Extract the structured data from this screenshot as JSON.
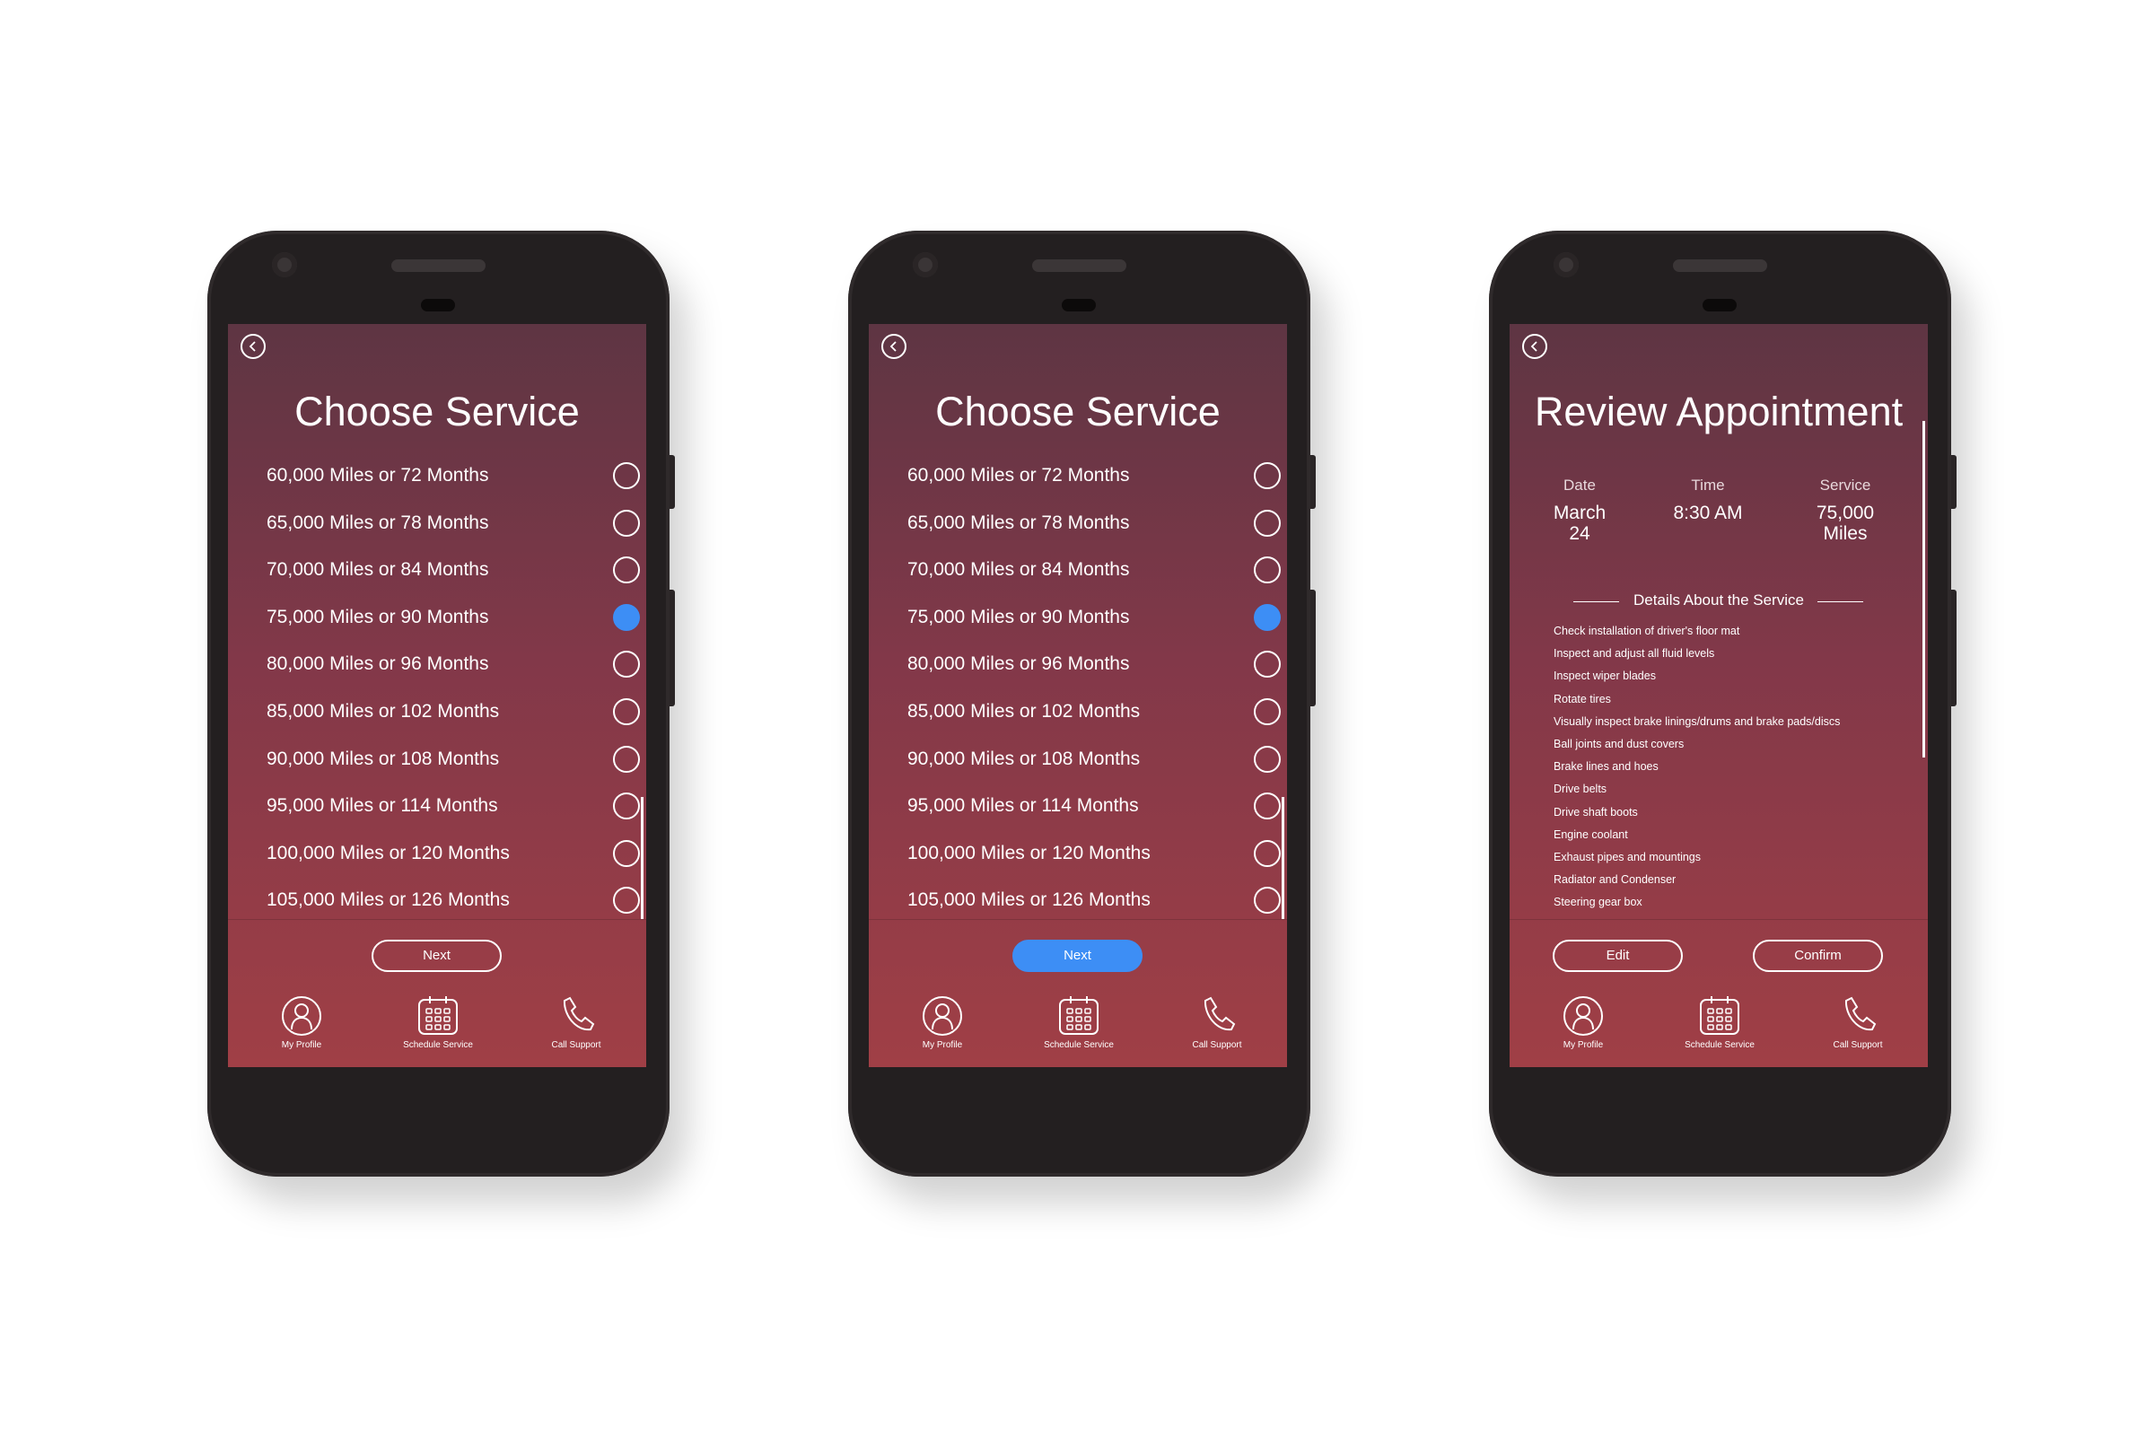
{
  "colors": {
    "accent": "#3d8ef5",
    "gradient_top": "#5e3543",
    "gradient_bottom": "#a03f46",
    "phone_body": "#231f20"
  },
  "nav": [
    {
      "label": "My Profile",
      "icon": "user-circle-icon"
    },
    {
      "label": "Schedule Service",
      "icon": "calendar-icon"
    },
    {
      "label": "Call Support",
      "icon": "phone-icon"
    }
  ],
  "screens": [
    {
      "type": "choose",
      "title": "Choose Service",
      "options": [
        "60,000 Miles or 72 Months",
        "65,000 Miles or 78 Months",
        "70,000 Miles or 84 Months",
        "75,000 Miles or 90 Months",
        "80,000 Miles or 96 Months",
        "85,000 Miles or 102 Months",
        "90,000 Miles or 108 Months",
        "95,000 Miles or 114 Months",
        "100,000 Miles or 120 Months",
        "105,000 Miles or 126 Months"
      ],
      "selected_index": 3,
      "next_label": "Next",
      "next_active": false
    },
    {
      "type": "choose",
      "title": "Choose Service",
      "options": [
        "60,000 Miles or 72 Months",
        "65,000 Miles or 78 Months",
        "70,000 Miles or 84 Months",
        "75,000 Miles or 90 Months",
        "80,000 Miles or 96 Months",
        "85,000 Miles or 102 Months",
        "90,000 Miles or 108 Months",
        "95,000 Miles or 114 Months",
        "100,000 Miles or 120 Months",
        "105,000 Miles or 126 Months"
      ],
      "selected_index": 3,
      "next_label": "Next",
      "next_active": true
    },
    {
      "type": "review",
      "title": "Review Appointment",
      "summary": [
        {
          "label": "Date",
          "value": "March 24"
        },
        {
          "label": "Time",
          "value": "8:30 AM"
        },
        {
          "label": "Service",
          "value": "75,000 Miles"
        }
      ],
      "details_heading": "Details About the Service",
      "details": [
        "Check installation of driver's floor mat",
        "Inspect and adjust all fluid levels",
        "Inspect wiper blades",
        "Rotate tires",
        "Visually inspect brake linings/drums and brake pads/discs",
        "Ball joints and dust covers",
        "Brake lines and hoes",
        "Drive belts",
        "Drive shaft boots",
        "Engine coolant",
        "Exhaust pipes and mountings",
        "Radiator and Condenser",
        "Steering gear box"
      ],
      "edit_label": "Edit",
      "confirm_label": "Confirm"
    }
  ]
}
